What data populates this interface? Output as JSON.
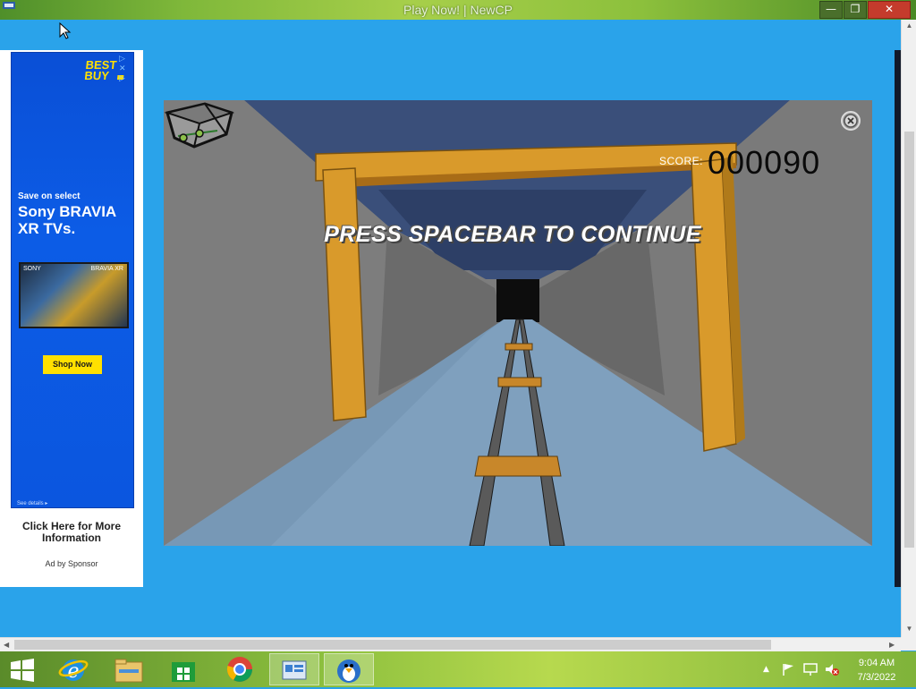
{
  "window": {
    "title": "Play Now! | NewCP",
    "minimize_symbol": "—",
    "restore_symbol": "❐",
    "close_symbol": "✕"
  },
  "ad": {
    "logo": "BEST BUY",
    "choices": "▷ ✕ ▷",
    "subline": "Save on select",
    "headline": "Sony BRAVIA XR TVs.",
    "tv_brand": "SONY",
    "tv_model": "BRAVIA XR",
    "cta_button": "Shop Now",
    "details": "See details ▸",
    "more_info": "Click Here for More Information",
    "sponsor": "Ad by Sponsor"
  },
  "game": {
    "score_label": "SCORE:",
    "score_value": "000090",
    "message": "PRESS SPACEBAR TO CONTINUE",
    "icons": [
      "mine-cart-icon",
      "close-icon"
    ]
  },
  "taskbar": {
    "apps": [
      "start-button",
      "internet-explorer-icon",
      "file-explorer-icon",
      "store-icon",
      "chrome-icon",
      "control-panel-icon",
      "club-penguin-icon"
    ],
    "time": "9:04 AM",
    "date": "7/3/2022",
    "tray_up": "▲"
  },
  "colors": {
    "page_bg": "#2aa3ea",
    "beam": "#d99a2b",
    "tunnel_wall": "#7c7c7c",
    "tunnel_floor": "#7fa0be"
  }
}
